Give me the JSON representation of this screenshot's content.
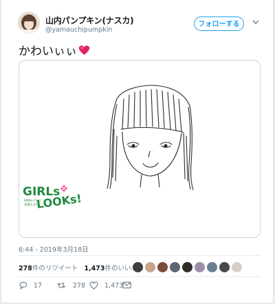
{
  "tweet": {
    "display_name": "山内パンプキン(ナスカ)",
    "handle": "@yamauchipumpkin",
    "follow_label": "フォローする",
    "text": "かわいぃぃ",
    "timestamp": "6:44 - 2019年3月18日"
  },
  "media": {
    "logo_line1": "GIRLs",
    "logo_line2": "LOOKs!",
    "logo_sub": "MON~THU",
    "logo_sub2": "深夜1:25~"
  },
  "stats": {
    "retweets": "278",
    "retweets_label": "件のリツイート",
    "likes": "1,473",
    "likes_label": "件のいいね"
  },
  "actions": {
    "reply_count": "17",
    "retweet_count": "278",
    "like_count": "1,473"
  },
  "colors": {
    "accent": "#1da1f2",
    "secondary_text": "#657786",
    "logo_green": "#1f8a3e",
    "heart": "#e0245e"
  },
  "icons": [
    "chevron-down-icon",
    "heart-emoji-icon",
    "reply-icon",
    "retweet-icon",
    "like-icon",
    "message-icon"
  ]
}
